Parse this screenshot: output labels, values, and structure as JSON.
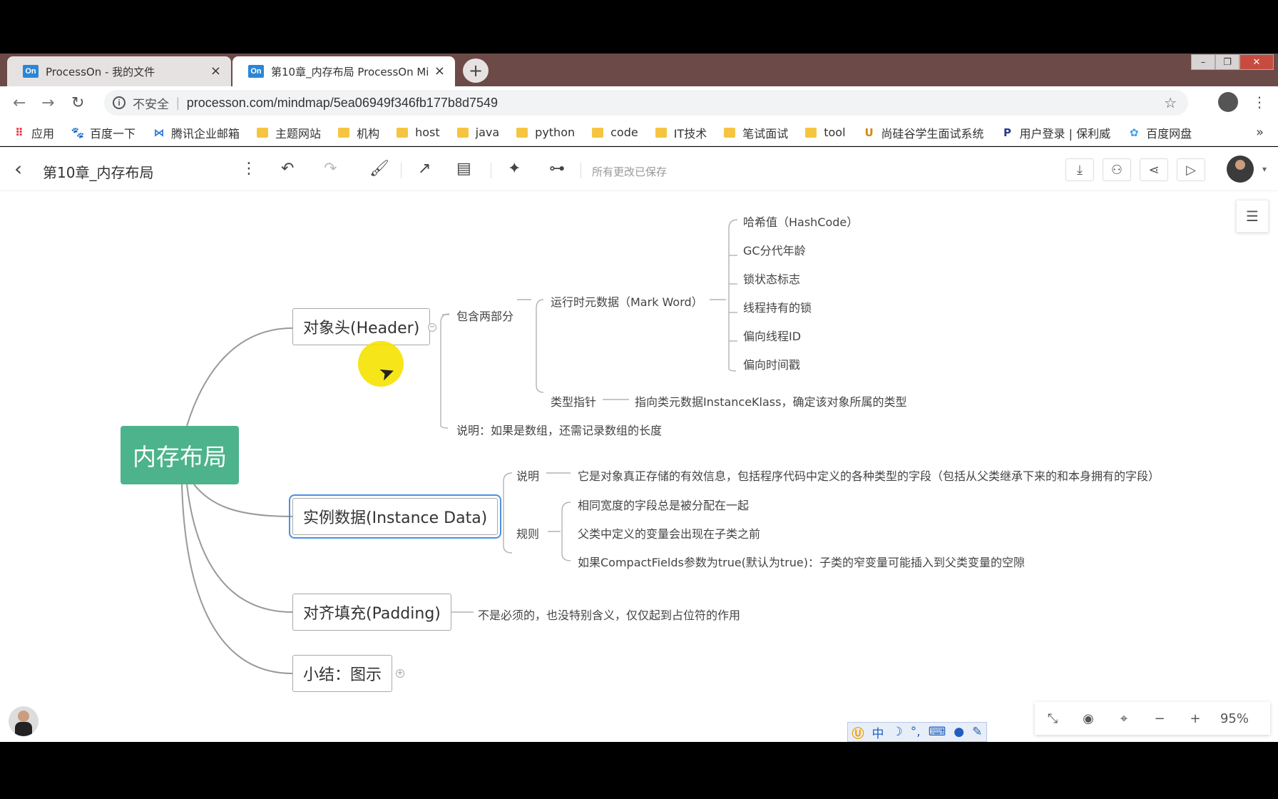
{
  "browser": {
    "tabs": [
      {
        "favicon": "On",
        "title": "ProcessOn - 我的文件",
        "close": "×"
      },
      {
        "favicon": "On",
        "title": "第10章_内存布局 ProcessOn Mi",
        "close": "×"
      }
    ],
    "new_tab": "+",
    "window_controls": {
      "minimize": "–",
      "maximize": "❐",
      "close": "✕"
    },
    "nav": {
      "back": "←",
      "forward": "→",
      "reload": "↻"
    },
    "address": {
      "info": "i",
      "security": "不安全",
      "url": "processon.com/mindmap/5ea06949f346fb177b8d7549",
      "star": "☆"
    },
    "menu": "⋮",
    "bookmarks": [
      {
        "label": "应用",
        "icon": "apps-grid-icon",
        "kind": "apps"
      },
      {
        "label": "百度一下",
        "icon": "baidu-paw-icon",
        "kind": "icon"
      },
      {
        "label": "腾讯企业邮箱",
        "icon": "tencent-mail-icon",
        "kind": "icon"
      },
      {
        "label": "主题网站",
        "kind": "folder"
      },
      {
        "label": "机构",
        "kind": "folder"
      },
      {
        "label": "host",
        "kind": "folder"
      },
      {
        "label": "java",
        "kind": "folder"
      },
      {
        "label": "python",
        "kind": "folder"
      },
      {
        "label": "code",
        "kind": "folder"
      },
      {
        "label": "IT技术",
        "kind": "folder"
      },
      {
        "label": "笔试面试",
        "kind": "folder"
      },
      {
        "label": "tool",
        "kind": "folder"
      },
      {
        "label": "尚硅谷学生面试系统",
        "icon": "atguigu-icon",
        "kind": "icon"
      },
      {
        "label": "用户登录 | 保利威",
        "icon": "polyv-icon",
        "kind": "icon"
      },
      {
        "label": "百度网盘",
        "icon": "baidu-pan-icon",
        "kind": "icon"
      }
    ],
    "bookmarks_more": "»"
  },
  "app": {
    "back": "‹",
    "doc_title": "第10章_内存布局",
    "more": "⋮",
    "saved_status": "所有更改已保存",
    "zoom": "95%",
    "zoom_minus": "−",
    "zoom_plus": "+"
  },
  "mindmap": {
    "root": "内存布局",
    "header": {
      "label": "对象头(Header)",
      "contains": "包含两部分",
      "mark_word": "运行时元数据（Mark Word）",
      "mark_items": [
        "哈希值（HashCode）",
        "GC分代年龄",
        "锁状态标志",
        "线程持有的锁",
        "偏向线程ID",
        "偏向时间戳"
      ],
      "type_pointer": "类型指针",
      "type_pointer_desc": "指向类元数据InstanceKlass，确定该对象所属的类型",
      "note": "说明：如果是数组，还需记录数组的长度"
    },
    "instance": {
      "label": "实例数据(Instance Data)",
      "desc_label": "说明",
      "desc": "它是对象真正存储的有效信息，包括程序代码中定义的各种类型的字段（包括从父类继承下来的和本身拥有的字段）",
      "rules_label": "规则",
      "rules": [
        "相同宽度的字段总是被分配在一起",
        "父类中定义的变量会出现在子类之前",
        "如果CompactFields参数为true(默认为true)：子类的窄变量可能插入到父类变量的空隙"
      ]
    },
    "padding": {
      "label": "对齐填充(Padding)",
      "desc": "不是必须的，也没特别含义，仅仅起到占位符的作用"
    },
    "summary": {
      "label": "小结：图示"
    }
  },
  "ime": {
    "items": [
      "中",
      "☽",
      "°,",
      "⌨",
      "●",
      "✎"
    ]
  }
}
